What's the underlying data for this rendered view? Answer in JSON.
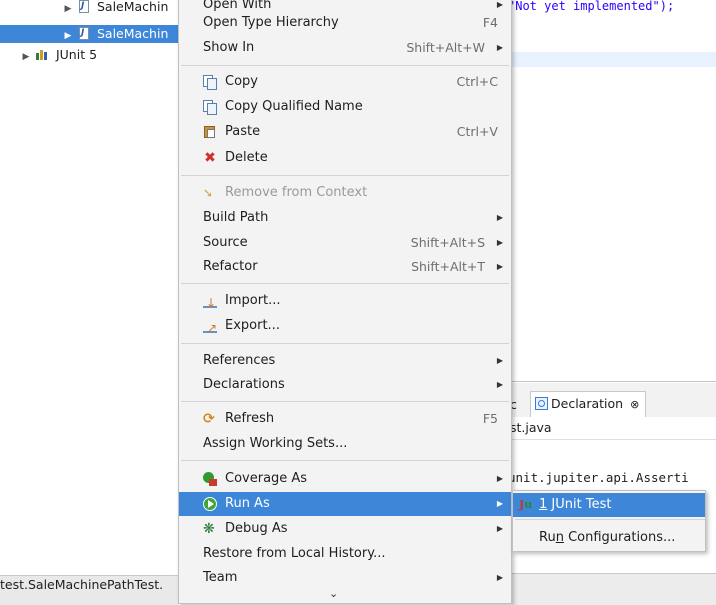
{
  "explorer": {
    "items": [
      {
        "label": "SaleMachin",
        "selected": false
      },
      {
        "label": "SaleMachin",
        "selected": true
      },
      {
        "label": "JUnit 5",
        "selected": false
      }
    ]
  },
  "editor": {
    "code_fragment": "\"Not yet implemented\");"
  },
  "views": {
    "tab_javadoc": "c",
    "tab_declaration": "Declaration",
    "tab_close": "⊗",
    "decl_file": "st.java",
    "decl_code": "unit.jupiter.api.Asserti"
  },
  "status": {
    "text": "test.SaleMachinePathTest."
  },
  "menu": {
    "open_with": "Open With",
    "open_type_hierarchy": {
      "label": "Open Type Hierarchy",
      "shortcut": "F4"
    },
    "show_in": {
      "label": "Show In",
      "shortcut": "Shift+Alt+W"
    },
    "copy": {
      "label": "Copy",
      "shortcut": "Ctrl+C"
    },
    "copy_qualified": {
      "label": "Copy Qualified Name"
    },
    "paste": {
      "label": "Paste",
      "shortcut": "Ctrl+V"
    },
    "delete": {
      "label": "Delete"
    },
    "remove_context": {
      "label": "Remove from Context"
    },
    "build_path": {
      "label": "Build Path"
    },
    "source": {
      "label": "Source",
      "shortcut": "Shift+Alt+S"
    },
    "refactor": {
      "label": "Refactor",
      "shortcut": "Shift+Alt+T"
    },
    "import": {
      "label": "Import..."
    },
    "export": {
      "label": "Export..."
    },
    "references": {
      "label": "References"
    },
    "declarations": {
      "label": "Declarations"
    },
    "refresh": {
      "label": "Refresh",
      "shortcut": "F5"
    },
    "assign_working_sets": {
      "label": "Assign Working Sets..."
    },
    "coverage_as": {
      "label": "Coverage As"
    },
    "run_as": {
      "label": "Run As"
    },
    "debug_as": {
      "label": "Debug As"
    },
    "restore_history": {
      "label": "Restore from Local History..."
    },
    "team": {
      "label": "Team"
    },
    "more_glyph": "⌄"
  },
  "submenu": {
    "junit_icon_a": "J",
    "junit_icon_b": "u",
    "junit_num": "1",
    "junit_label": " JUnit Test",
    "run_config_a": "Ru",
    "run_config_u": "n",
    "run_config_b": " Configurations..."
  },
  "colors": {
    "selection": "#3d86d8",
    "menu_bg": "#f3f3f3"
  }
}
